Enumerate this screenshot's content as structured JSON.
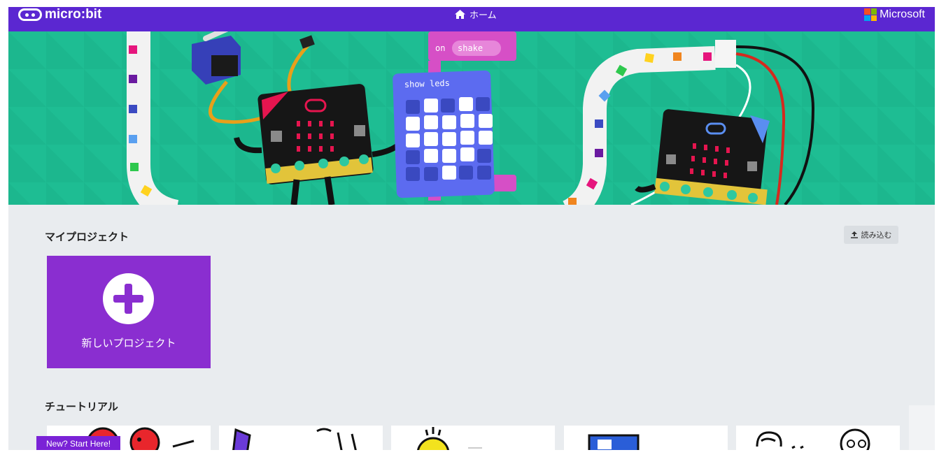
{
  "topbar": {
    "brand": "micro:bit",
    "home_label": "ホーム",
    "microsoft_label": "Microsoft",
    "colors": {
      "bar": "#5b27d1"
    }
  },
  "hero": {
    "code_block_on": "on",
    "code_block_event": "shake",
    "show_leds_label": "show leds",
    "colors": {
      "background": "#1ebd93",
      "block_magenta": "#d64fc6",
      "block_blue": "#5c6bf0"
    }
  },
  "my_projects": {
    "title": "マイプロジェクト",
    "import_label": "読み込む",
    "new_project_label": "新しいプロジェクト",
    "card_color": "#8a2ed0"
  },
  "tutorials": {
    "title": "チュートリアル",
    "badge": "New? Start Here!"
  }
}
